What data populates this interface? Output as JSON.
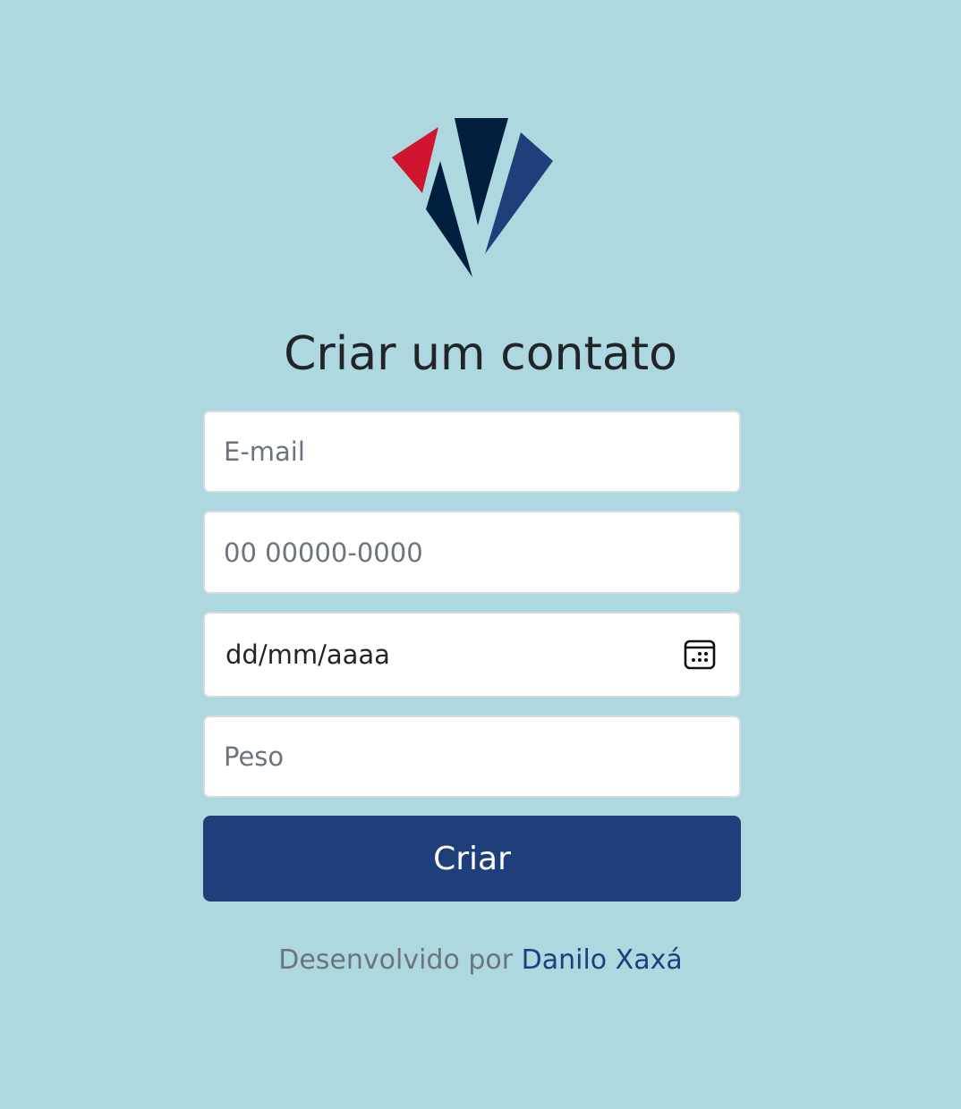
{
  "header": {
    "logo_icon": "brand-logo-icon",
    "title": "Criar um contato"
  },
  "form": {
    "email_placeholder": "E-mail",
    "phone_placeholder": "00 00000-0000",
    "date_value": "dd/mm/aaaa",
    "date_icon": "calendar-icon",
    "weight_placeholder": "Peso",
    "submit_label": "Criar"
  },
  "footer": {
    "prefix": "Desenvolvido por",
    "author_link": "Danilo Xaxá"
  },
  "colors": {
    "background": "#add8e0",
    "primary": "#1e3f7a",
    "logo_red": "#d01530",
    "logo_navy": "#001f3f",
    "logo_blue": "#1e3f7a"
  }
}
